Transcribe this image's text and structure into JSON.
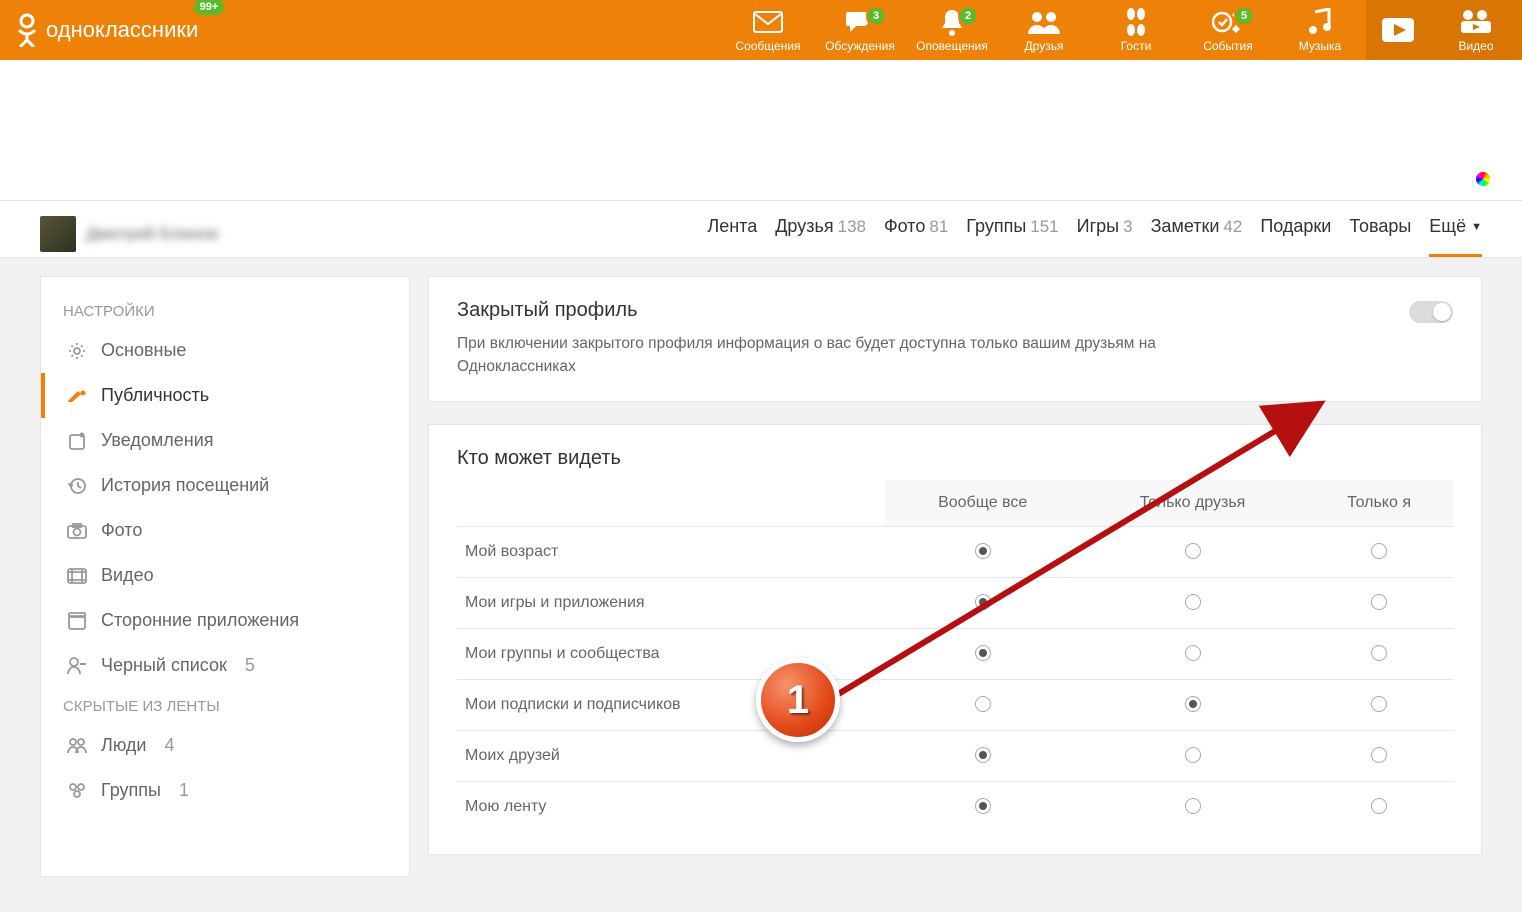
{
  "site_name": "одноклассники",
  "header_badge": "99+",
  "topnav": [
    {
      "id": "messages",
      "label": "Сообщения",
      "badge": null
    },
    {
      "id": "discussions",
      "label": "Обсуждения",
      "badge": "3"
    },
    {
      "id": "notifications",
      "label": "Оповещения",
      "badge": "2"
    },
    {
      "id": "friends",
      "label": "Друзья",
      "badge": null
    },
    {
      "id": "guests",
      "label": "Гости",
      "badge": null
    },
    {
      "id": "events",
      "label": "События",
      "badge": "5"
    },
    {
      "id": "music",
      "label": "Музыка",
      "badge": null
    },
    {
      "id": "play",
      "label": "",
      "badge": null
    },
    {
      "id": "video",
      "label": "Видео",
      "badge": null
    }
  ],
  "profile": {
    "name": "Дмитрий Блинов",
    "nav": [
      {
        "label": "Лента",
        "count": null,
        "active": false
      },
      {
        "label": "Друзья",
        "count": "138",
        "active": false
      },
      {
        "label": "Фото",
        "count": "81",
        "active": false
      },
      {
        "label": "Группы",
        "count": "151",
        "active": false
      },
      {
        "label": "Игры",
        "count": "3",
        "active": false
      },
      {
        "label": "Заметки",
        "count": "42",
        "active": false
      },
      {
        "label": "Подарки",
        "count": null,
        "active": false
      },
      {
        "label": "Товары",
        "count": null,
        "active": false
      },
      {
        "label": "Ещё",
        "count": null,
        "active": true
      }
    ]
  },
  "sidebar": {
    "title1": "НАСТРОЙКИ",
    "items": [
      {
        "id": "basic",
        "label": "Основные"
      },
      {
        "id": "publicity",
        "label": "Публичность",
        "active": true
      },
      {
        "id": "notify",
        "label": "Уведомления"
      },
      {
        "id": "history",
        "label": "История посещений"
      },
      {
        "id": "photo",
        "label": "Фото"
      },
      {
        "id": "video",
        "label": "Видео"
      },
      {
        "id": "apps",
        "label": "Сторонние приложения"
      },
      {
        "id": "blacklist",
        "label": "Черный список",
        "count": "5"
      }
    ],
    "title2": "СКРЫТЫЕ ИЗ ЛЕНТЫ",
    "hidden": [
      {
        "id": "people",
        "label": "Люди",
        "count": "4"
      },
      {
        "id": "groups",
        "label": "Группы",
        "count": "1"
      }
    ]
  },
  "private_card": {
    "title": "Закрытый профиль",
    "desc": "При включении закрытого профиля информация о вас будет доступна только вашим друзьям на Одноклассниках",
    "enabled": false
  },
  "perm_section": {
    "title": "Кто может видеть",
    "columns": [
      "Вообще все",
      "Только друзья",
      "Только я"
    ],
    "rows": [
      {
        "label": "Мой возраст",
        "sel": 0
      },
      {
        "label": "Мои игры и приложения",
        "sel": 0
      },
      {
        "label": "Мои группы и сообщества",
        "sel": 0
      },
      {
        "label": "Мои подписки и подписчиков",
        "sel": 1
      },
      {
        "label": "Моих друзей",
        "sel": 0
      },
      {
        "label": "Мою ленту",
        "sel": 0
      }
    ]
  },
  "annotation_step": "1"
}
